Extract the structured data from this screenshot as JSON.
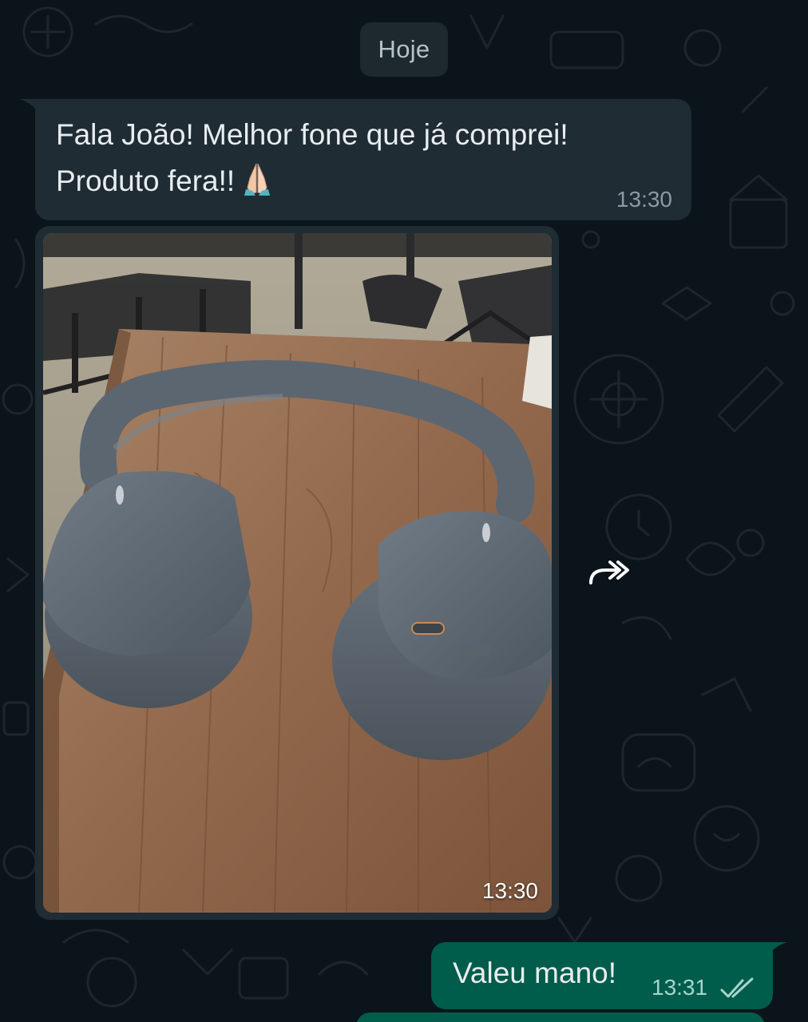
{
  "date_chip": "Hoje",
  "messages": {
    "incoming_text": {
      "line1": "Fala João! Melhor fone que já comprei!",
      "line2": "Produto fera!!",
      "emoji": "🙏",
      "time": "13:30"
    },
    "incoming_image": {
      "time": "13:30"
    },
    "outgoing": {
      "text": "Valeu mano!",
      "time": "13:31",
      "status": "read"
    }
  },
  "icons": {
    "forward": "forward-icon",
    "read_receipt": "double-check-icon",
    "emoji": "folded-hands-emoji"
  },
  "colors": {
    "background": "#0b141a",
    "incoming_bubble": "#1f2c34",
    "outgoing_bubble": "#005c4b",
    "text": "#e9edef",
    "timestamp": "#8a9aa3"
  }
}
